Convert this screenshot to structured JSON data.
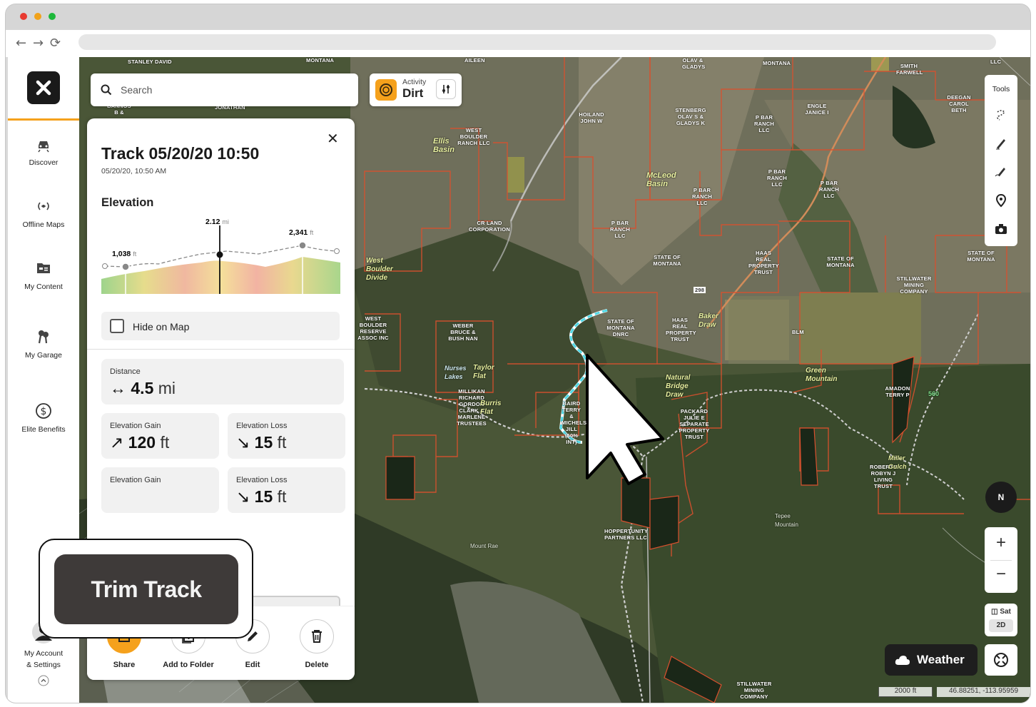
{
  "colors": {
    "accent": "#f5a11c",
    "track": "#4fd9e6",
    "boundary": "#d9502e"
  },
  "nav": [
    {
      "label": "Discover",
      "icon": "discover-icon"
    },
    {
      "label": "Offline Maps",
      "icon": "offline-maps-icon"
    },
    {
      "label": "My Content",
      "icon": "my-content-icon"
    },
    {
      "label": "My Garage",
      "icon": "my-garage-icon"
    },
    {
      "label": "Elite Benefits",
      "icon": "elite-benefits-icon"
    }
  ],
  "account": {
    "label_line1": "My Account",
    "label_line2": "& Settings"
  },
  "search": {
    "placeholder": "Search"
  },
  "activity": {
    "label": "Activity",
    "value": "Dirt"
  },
  "tools": {
    "label": "Tools"
  },
  "layer": {
    "label": "Sat",
    "mode": "2D"
  },
  "weather": {
    "label": "Weather"
  },
  "compass": {
    "label": "N"
  },
  "scale": {
    "label": "2000 ft"
  },
  "coords": {
    "label": "46.88251, -113.95959"
  },
  "panel": {
    "title": "Track 05/20/20 10:50",
    "subtitle": "05/20/20, 10:50 AM",
    "elevation_heading": "Elevation",
    "chart": {
      "marker_value": "2.12",
      "marker_unit": "mi",
      "min_value": "1,038",
      "min_unit": "ft",
      "max_value": "2,341",
      "max_unit": "ft"
    },
    "hide_on_map": "Hide on Map",
    "distance": {
      "label": "Distance",
      "value": "4.5",
      "unit": "mi"
    },
    "gain": {
      "label": "Elevation Gain",
      "value": "120",
      "unit": "ft"
    },
    "loss": {
      "label": "Elevation Loss",
      "value": "15",
      "unit": "ft"
    },
    "gain2": {
      "label": "Elevation Gain"
    },
    "loss2": {
      "label": "Elevation Loss",
      "value": "15",
      "unit": "ft"
    },
    "actions": [
      "Share",
      "Add to Folder",
      "Edit",
      "Delete"
    ]
  },
  "trim": {
    "label": "Trim Track"
  },
  "map_labels": [
    "STANLEY DAVID",
    "MONTANA",
    "AILEEN",
    "OLAV & GLADYS",
    "MONTANA",
    "SMITH FARWELL",
    "LLC",
    "BANNOS B &",
    "JONATHAN",
    "HOILAND JOHN W",
    "STENBERG OLAV S & GLADYS K",
    "P BAR RANCH LLC",
    "ENGLE JANICE I",
    "DEEGAN CAROL BETH",
    "WEST BOULDER RANCH LLC",
    "P BAR RANCH LLC",
    "P BAR RANCH LLC",
    "P BAR RANCH LLC",
    "CR LAND CORPORATION",
    "P BAR RANCH LLC",
    "STATE OF MONTANA",
    "HAAS REAL PROPERTY TRUST",
    "STATE OF MONTANA",
    "STILLWATER MINING COMPANY",
    "STATE OF MONTANA",
    "WEST BOULDER RESERVE ASSOC INC",
    "WEBER BRUCE & BUSH NAN",
    "STATE OF MONTANA DNRC",
    "HAAS REAL PROPERTY TRUST",
    "BLM",
    "MILLIKAN RICHARD GORDON CLARK & MARLENE TRUSTEES",
    "BAIRD TERRY & MICHELS JILL (50% INT)",
    "PACKARD JULIE E SEPARATE PROPERTY TRUST",
    "AMADON TERRY P",
    "ROBERTS ROBYN J LIVING TRUST",
    "HOPPERTUNITY PARTNERS LLC",
    "STILLWATER MINING COMPANY",
    "Ellis Basin",
    "McLeod Basin",
    "West Boulder Divide",
    "Baker Draw",
    "Green Mountain",
    "Nurses Lakes",
    "Taylor Flat",
    "Burris Flat",
    "Natural Bridge Draw",
    "Tepee Mountain",
    "Mount Rae",
    "Miller Gulch",
    "560",
    "298"
  ]
}
